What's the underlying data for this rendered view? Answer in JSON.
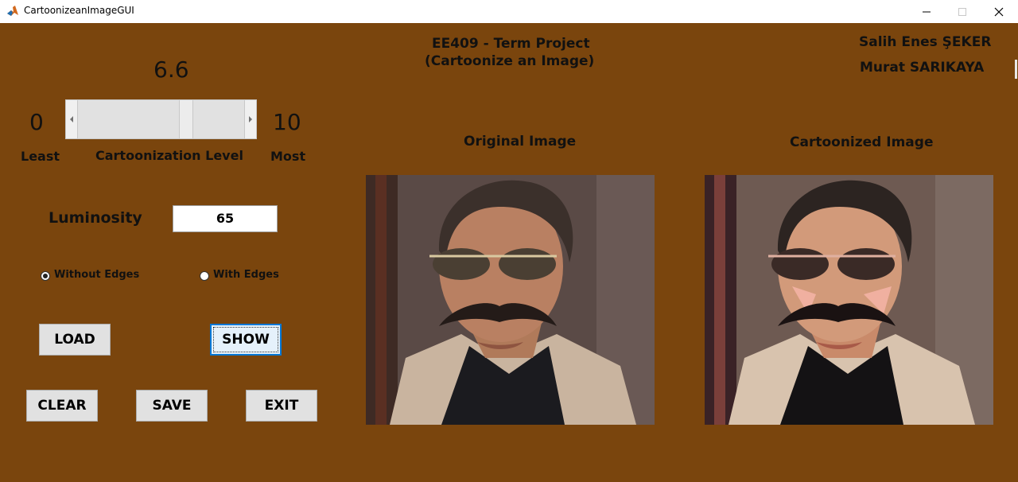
{
  "window": {
    "title": "CartoonizeanImageGUI",
    "icon": "matlab-icon"
  },
  "header": {
    "project_line1": "EE409 - Term Project",
    "project_line2": "(Cartoonize an Image)",
    "author1": "Salih Enes ŞEKER",
    "author2": "Murat SARIKAYA"
  },
  "slider": {
    "current_value_text": "6.6",
    "value": 6.6,
    "min_text": "0",
    "max_text": "10",
    "min_caption": "Least",
    "max_caption": "Most",
    "label": "Cartoonization Level"
  },
  "luminosity": {
    "label": "Luminosity",
    "value": "65"
  },
  "edge_options": {
    "without_edges": "Without Edges",
    "with_edges": "With Edges",
    "selected": "without_edges"
  },
  "buttons": {
    "load": "LOAD",
    "show": "SHOW",
    "clear": "CLEAR",
    "save": "SAVE",
    "exit": "EXIT"
  },
  "images": {
    "original_title": "Original Image",
    "cartoonized_title": "Cartoonized Image"
  },
  "colors": {
    "panel_background": "#7a450d",
    "focus_accent": "#0078d7"
  }
}
